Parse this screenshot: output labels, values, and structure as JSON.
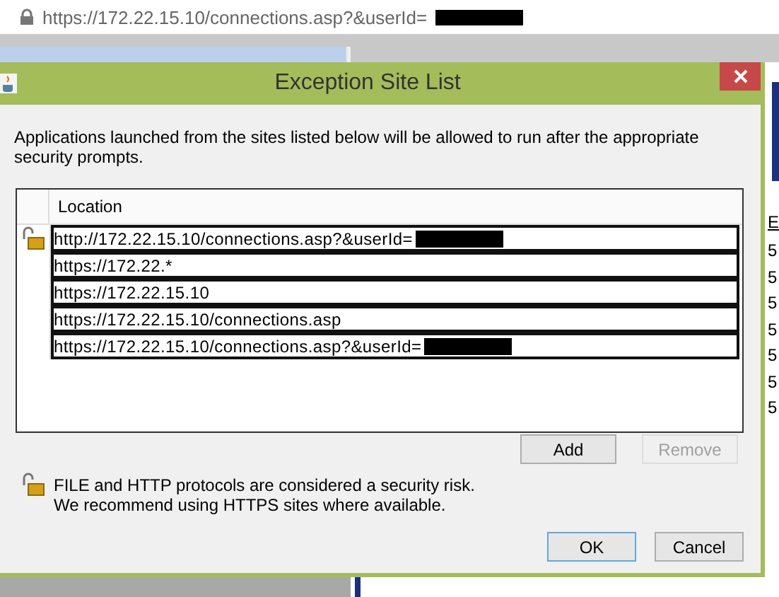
{
  "address_bar": {
    "url": "https://172.22.15.10/connections.asp?&userId=",
    "redacted": true
  },
  "dialog": {
    "title": "Exception Site List",
    "description": "Applications launched from the sites listed below will be allowed to run after the appropriate security prompts.",
    "table": {
      "columns": [
        "Location"
      ],
      "rows": [
        {
          "location": "http://172.22.15.10/connections.asp?&userId=",
          "insecure": true,
          "redacted": true
        },
        {
          "location": "https://172.22.*",
          "insecure": false,
          "redacted": false
        },
        {
          "location": "https://172.22.15.10",
          "insecure": false,
          "redacted": false
        },
        {
          "location": "https://172.22.15.10/connections.asp",
          "insecure": false,
          "redacted": false
        },
        {
          "location": "https://172.22.15.10/connections.asp?&userId=",
          "insecure": false,
          "redacted": true
        }
      ]
    },
    "list_buttons": [
      {
        "label": "Add",
        "disabled": false
      },
      {
        "label": "Remove",
        "disabled": true
      }
    ],
    "warning": [
      "FILE and HTTP protocols are considered a security risk.",
      "We recommend using HTTPS sites where available."
    ],
    "buttons": [
      {
        "label": "OK",
        "default": true
      },
      {
        "label": "Cancel",
        "default": false
      }
    ]
  },
  "background_column": {
    "header": "E",
    "cells": [
      "5",
      "5",
      "5",
      "5",
      "5",
      "5",
      "5"
    ]
  }
}
